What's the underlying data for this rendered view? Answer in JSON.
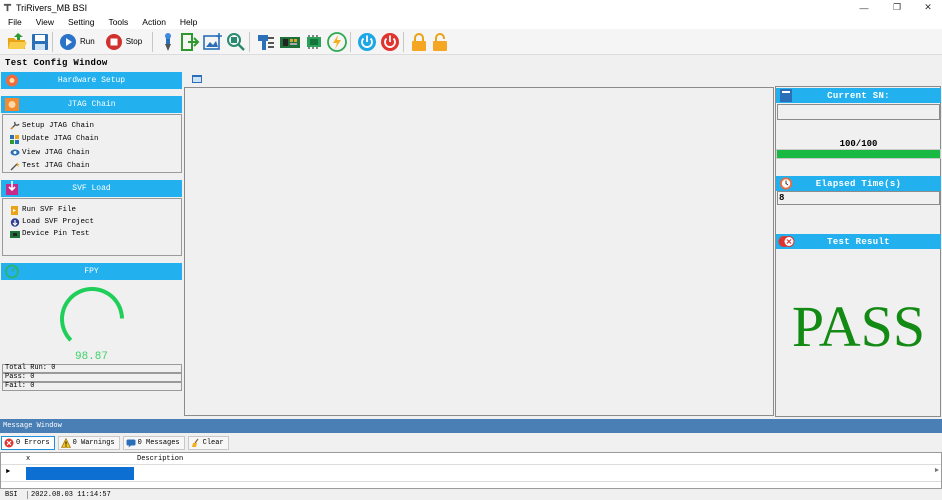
{
  "window": {
    "title": "TriRivers_MB BSI",
    "minimize": "—",
    "restore": "❐",
    "close": "✕"
  },
  "menu": [
    "File",
    "View",
    "Setting",
    "Tools",
    "Action",
    "Help"
  ],
  "toolbar": {
    "run_label": "Run",
    "stop_label": "Stop",
    "icons": [
      "open-folder-icon",
      "save-icon",
      "run-icon",
      "stop-icon",
      "probe-icon",
      "export-icon",
      "image-add-icon",
      "search-chip-icon",
      "programmer-icon",
      "board-icon",
      "chip-green-icon",
      "lightning-icon",
      "power-cyan-icon",
      "power-red-icon",
      "lock-icon",
      "unlock-icon"
    ]
  },
  "test_config_title": "Test Config Window",
  "left": {
    "hardware_setup": "Hardware Setup",
    "jtag_chain": {
      "header": "JTAG Chain",
      "items": [
        "Setup JTAG Chain",
        "Update JTAG Chain",
        "View JTAG Chain",
        "Test JTAG Chain"
      ]
    },
    "svf_load": {
      "header": "SVF Load",
      "items": [
        "Run SVF File",
        "Load SVF Project",
        "Device Pin Test"
      ]
    },
    "fpy": {
      "header": "FPY",
      "value": "98.87",
      "gauge_fraction": 0.83
    },
    "stats": {
      "total_run": "Total Run: 0",
      "pass": "Pass: 0",
      "fail": "Fail: 0"
    }
  },
  "right": {
    "current_sn_header": "Current SN:",
    "current_sn_value": "",
    "progress_text": "100/100",
    "progress_fraction": 1.0,
    "elapsed_header": "Elapsed Time(s)",
    "elapsed_value": "8",
    "result_header": "Test Result",
    "result_value": "PASS"
  },
  "message_window": {
    "title": "Message Window",
    "tabs": {
      "errors": "0 Errors",
      "warnings": "0 Warnings",
      "messages": "0 Messages",
      "clear": "Clear"
    },
    "columns": [
      "x",
      "Description"
    ]
  },
  "status": {
    "name": "BSI",
    "timestamp": "2022.08.03 11:14:57"
  },
  "colors": {
    "header_blue": "#22b1ee",
    "msg_header": "#4a7fb5",
    "pass_green": "#138a13",
    "gauge_green": "#1fcf59",
    "progress_green": "#19b943"
  }
}
